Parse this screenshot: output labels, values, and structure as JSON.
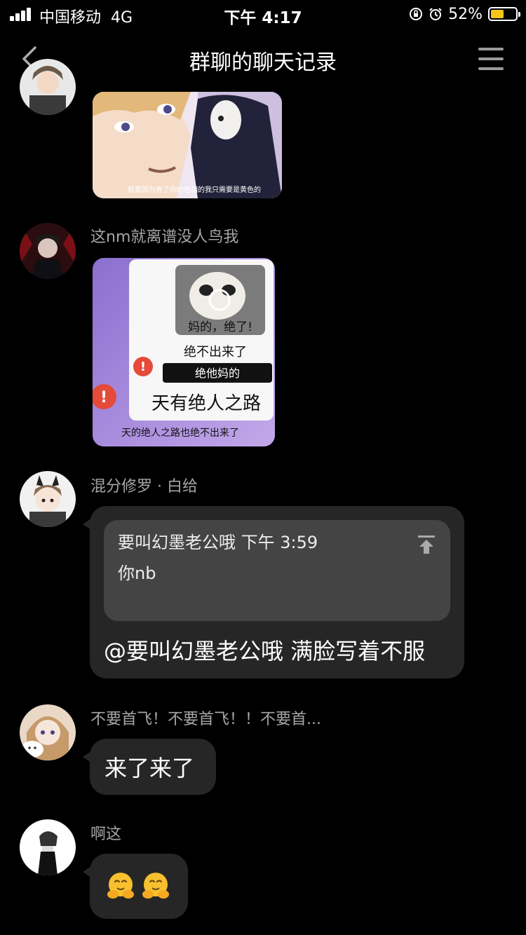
{
  "status_bar": {
    "carrier": "中国移动",
    "network": "4G",
    "time": "下午 4:17",
    "battery_text": "52%",
    "battery_level": 0.52,
    "battery_color": "#f5c518"
  },
  "nav": {
    "back_icon": "chevron-left-icon",
    "title": "群聊的聊天记录",
    "menu_icon": "hamburger-menu-icon"
  },
  "messages": [
    {
      "type": "image",
      "avatar": "anime-character-avatar",
      "image": "anime-meme-sticker",
      "caption": "就是因为有了你的色相的我只需要是黄色的"
    },
    {
      "type": "image",
      "sender": "这nm就离谱没人鸟我",
      "avatar": "dark-anime-character-avatar",
      "image": "panda-meme-sticker",
      "sticker_lines": [
        "妈的，绝了!",
        "绝不出来了",
        "绝他妈的",
        "天有绝人之路",
        "天的绝人之路也绝不出来了"
      ]
    },
    {
      "type": "quote",
      "sender": "混分修罗 · 白给",
      "avatar": "chibi-anime-avatar",
      "quote_header": "要叫幻墨老公哦 下午 3:59",
      "quote_body": "你nb",
      "text": "@要叫幻墨老公哦 满脸写着不服"
    },
    {
      "type": "text",
      "sender": "不要首飞！不要首飞！！不要首...",
      "avatar": "anime-girl-with-cat-avatar",
      "text": "来了来了"
    },
    {
      "type": "emoji",
      "sender": "啊这",
      "avatar": "sketch-boy-avatar",
      "emojis": [
        "hugging-face-emoji",
        "hugging-face-emoji"
      ]
    }
  ],
  "colors": {
    "bubble": "#262626",
    "quote_box": "#444444",
    "sender_text": "#a6a6a6"
  }
}
